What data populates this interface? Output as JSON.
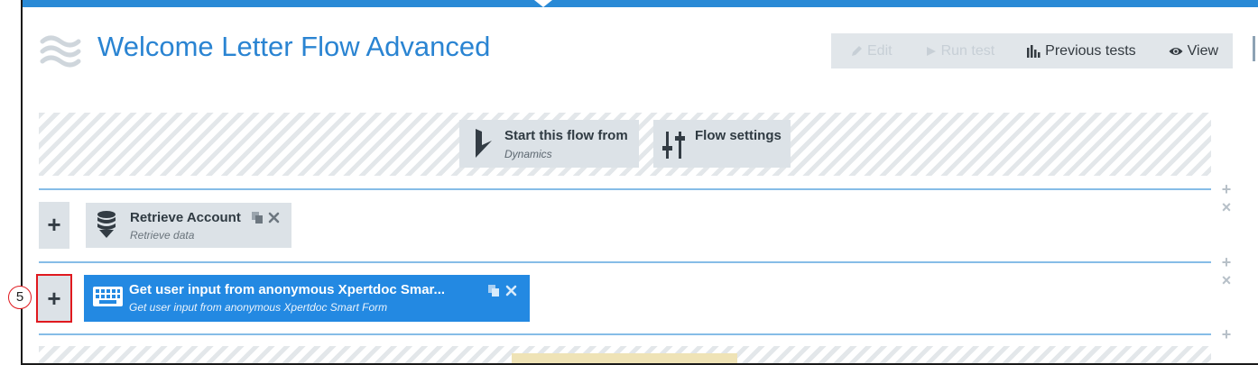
{
  "header": {
    "title": "Welcome Letter Flow Advanced",
    "logo_icon": "waves-icon"
  },
  "toolbar": {
    "edit_label": "Edit",
    "run_test_label": "Run test",
    "previous_tests_label": "Previous tests",
    "view_label": "View"
  },
  "start_flow": {
    "label": "Start this flow from",
    "sub": "Dynamics",
    "icon": "dynamics-icon"
  },
  "flow_settings": {
    "label": "Flow settings",
    "icon": "sliders-icon"
  },
  "steps": [
    {
      "label": "Retrieve Account",
      "sub": "Retrieve data",
      "icon": "database-icon",
      "selected": false
    },
    {
      "label": "Get user input from anonymous Xpertdoc Smar...",
      "sub": "Get user input from anonymous Xpertdoc Smart Form",
      "icon": "keyboard-icon",
      "selected": true
    }
  ],
  "add_label": "+",
  "side_add": "+",
  "side_remove": "×",
  "annotation": {
    "number": "5"
  },
  "colors": {
    "accent": "#2a84d2",
    "selected_step": "#2389e2",
    "highlight_border": "#e0191f"
  }
}
